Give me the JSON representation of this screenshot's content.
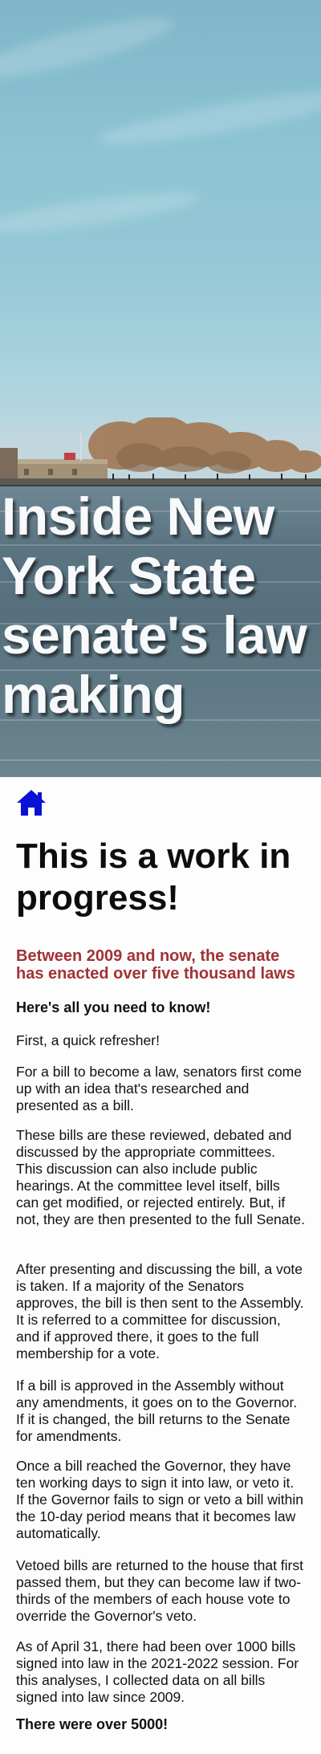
{
  "hero": {
    "title": "Inside New York State senate's law making"
  },
  "nav": {
    "home_icon": "home-icon",
    "home_color": "#0a10d6"
  },
  "main": {
    "heading": "This is a work in progress!",
    "subtitle": "Between 2009 and now, the senate has enacted over five thousand laws",
    "lead": "Here's all you need to know!",
    "paragraphs": [
      "First, a quick refresher!",
      "For a bill to become a law, senators first come up with an idea that's researched and presented as a bill.",
      "These bills are these reviewed, debated and discussed by the appropriate committees. This discussion can also include public hearings. At the committee level itself, bills can get modified, or rejected entirely. But, if not, they are then presented to the full Senate.",
      "After presenting and discussing the bill, a vote is taken. If a majority of the Senators approves, the bill is then sent to the Assembly. It is referred to a committee for discussion, and if approved there, it goes to the full membership for a vote.",
      "If a bill is approved in the Assembly without any amendments, it goes on to the Governor. If it is changed, the bill returns to the Senate for amendments.",
      "Once a bill reached the Governor, they have ten working days to sign it into law, or veto it. If the Governor fails to sign or veto a bill within the 10-day period means that it becomes law automatically.",
      "Vetoed bills are returned to the house that first passed them, but they can become law if two-thirds of the members of each house vote to override the Governor's veto.",
      "As of April 31, there had been over 1000 bills signed into law in the 2021-2022 session. For this analyses, I collected data on all bills signed into law since 2009."
    ],
    "closing": "There were over 5000!"
  },
  "colors": {
    "subtitle": "#a23235",
    "text": "#111111"
  }
}
